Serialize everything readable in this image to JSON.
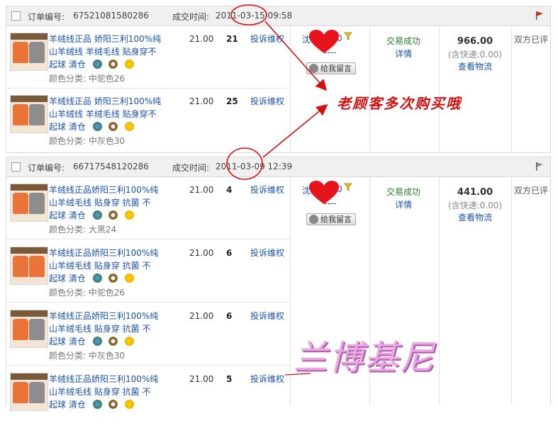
{
  "orders": [
    {
      "order_no_label": "订单编号:",
      "order_no": "67521081580286",
      "deal_time_label": "成交时间:",
      "deal_time": "2011-03-15 09:58",
      "flag_color": "#d81e06",
      "buyer": "沈",
      "buyer_tail": "0",
      "buyer_sub": "----",
      "leave_msg": "给我留言",
      "status": "交易成功",
      "detail": "详情",
      "total": "966.00",
      "shipping": "(含快递:0.00)",
      "logistics": "查看物流",
      "rating": "双方已评",
      "items": [
        {
          "title_l1": "羊绒线正品 娇阳三利100%纯",
          "title_l2": "山羊绒线 羊绒毛线 贴身穿不",
          "title_l3": "起球 清仓",
          "color_spec": "颜色分类: 中驼色26",
          "price": "21.00",
          "qty": "21",
          "complain": "投诉维权"
        },
        {
          "title_l1": "羊绒线正品 娇阳三利100%纯",
          "title_l2": "山羊绒线 羊绒毛线 贴身穿不",
          "title_l3": "起球 清仓",
          "color_spec": "颜色分类: 中灰色30",
          "price": "21.00",
          "qty": "25",
          "complain": "投诉维权"
        }
      ]
    },
    {
      "order_no_label": "订单编号:",
      "order_no": "66717548120286",
      "deal_time_label": "成交时间:",
      "deal_time": "2011-03-09 12:39",
      "flag_color": "#8a8a8a",
      "buyer": "沈",
      "buyer_tail": "0",
      "buyer_sub": "----",
      "leave_msg": "给我留言",
      "status": "交易成功",
      "detail": "详情",
      "total": "441.00",
      "shipping": "(含快递:0.00)",
      "logistics": "查看物流",
      "rating": "双方已评",
      "items": [
        {
          "title_l1": "羊绒线正品娇阳三利100%纯",
          "title_l2": "山羊绒毛线 贴身穿 抗菌 不",
          "title_l3": "起球 清仓",
          "color_spec": "颜色分类: 大黑24",
          "price": "21.00",
          "qty": "4",
          "complain": "投诉维权"
        },
        {
          "title_l1": "羊绒线正品娇阳三利100%纯",
          "title_l2": "山羊绒毛线 贴身穿 抗菌 不",
          "title_l3": "起球 清仓",
          "color_spec": "颜色分类: 中驼色26",
          "price": "21.00",
          "qty": "6",
          "complain": "投诉维权"
        },
        {
          "title_l1": "羊绒线正品娇阳三利100%纯",
          "title_l2": "山羊绒毛线 贴身穿 抗菌 不",
          "title_l3": "起球 清仓",
          "color_spec": "颜色分类: 中灰色30",
          "price": "21.00",
          "qty": "6",
          "complain": "投诉维权"
        },
        {
          "title_l1": "羊绒线正品娇阳三利100%纯",
          "title_l2": "山羊绒毛线 贴身穿 抗菌 不",
          "title_l3": "起球 清仓",
          "color_spec": "",
          "price": "21.00",
          "qty": "5",
          "complain": "投诉维权"
        }
      ]
    }
  ],
  "annotation": "老顾客多次购买哦",
  "watermark": "兰博基尼",
  "colors": {
    "link": "#1a52a8",
    "success": "#2a7c2a",
    "annotation": "#d41010",
    "watermark": "#e7a9e0",
    "heart": "#e8141c"
  },
  "icons": {
    "red_flag": "flag-icon",
    "gray_flag": "flag-icon",
    "heart": "heart-icon",
    "message": "message-icon",
    "filter": "funnel-icon"
  }
}
